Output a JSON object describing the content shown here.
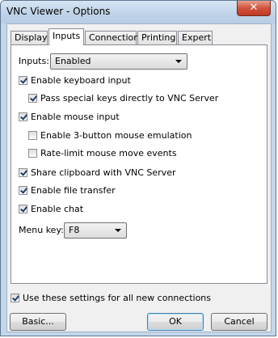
{
  "window": {
    "title": "VNC Viewer - Options",
    "close_glyph": "✕"
  },
  "tabs": [
    {
      "label": "Display",
      "active": false
    },
    {
      "label": "Inputs",
      "active": true
    },
    {
      "label": "Connection",
      "active": false
    },
    {
      "label": "Printing",
      "active": false
    },
    {
      "label": "Expert",
      "active": false
    }
  ],
  "inputs_panel": {
    "inputs_label": "Inputs:",
    "inputs_value": "Enabled",
    "options": [
      {
        "label": "Enable keyboard input",
        "checked": true
      },
      {
        "label": "Pass special keys directly to VNC Server",
        "checked": true
      },
      {
        "label": "Enable mouse input",
        "checked": true
      },
      {
        "label": "Enable 3-button mouse emulation",
        "checked": false
      },
      {
        "label": "Rate-limit mouse move events",
        "checked": false
      },
      {
        "label": "Share clipboard with VNC Server",
        "checked": true
      },
      {
        "label": "Enable file transfer",
        "checked": true
      },
      {
        "label": "Enable chat",
        "checked": true
      }
    ],
    "menu_key_label": "Menu key:",
    "menu_key_value": "F8"
  },
  "footer": {
    "use_for_all_label": "Use these settings for all new connections",
    "use_for_all_checked": true,
    "basic_label": "Basic...",
    "ok_label": "OK",
    "cancel_label": "Cancel"
  }
}
